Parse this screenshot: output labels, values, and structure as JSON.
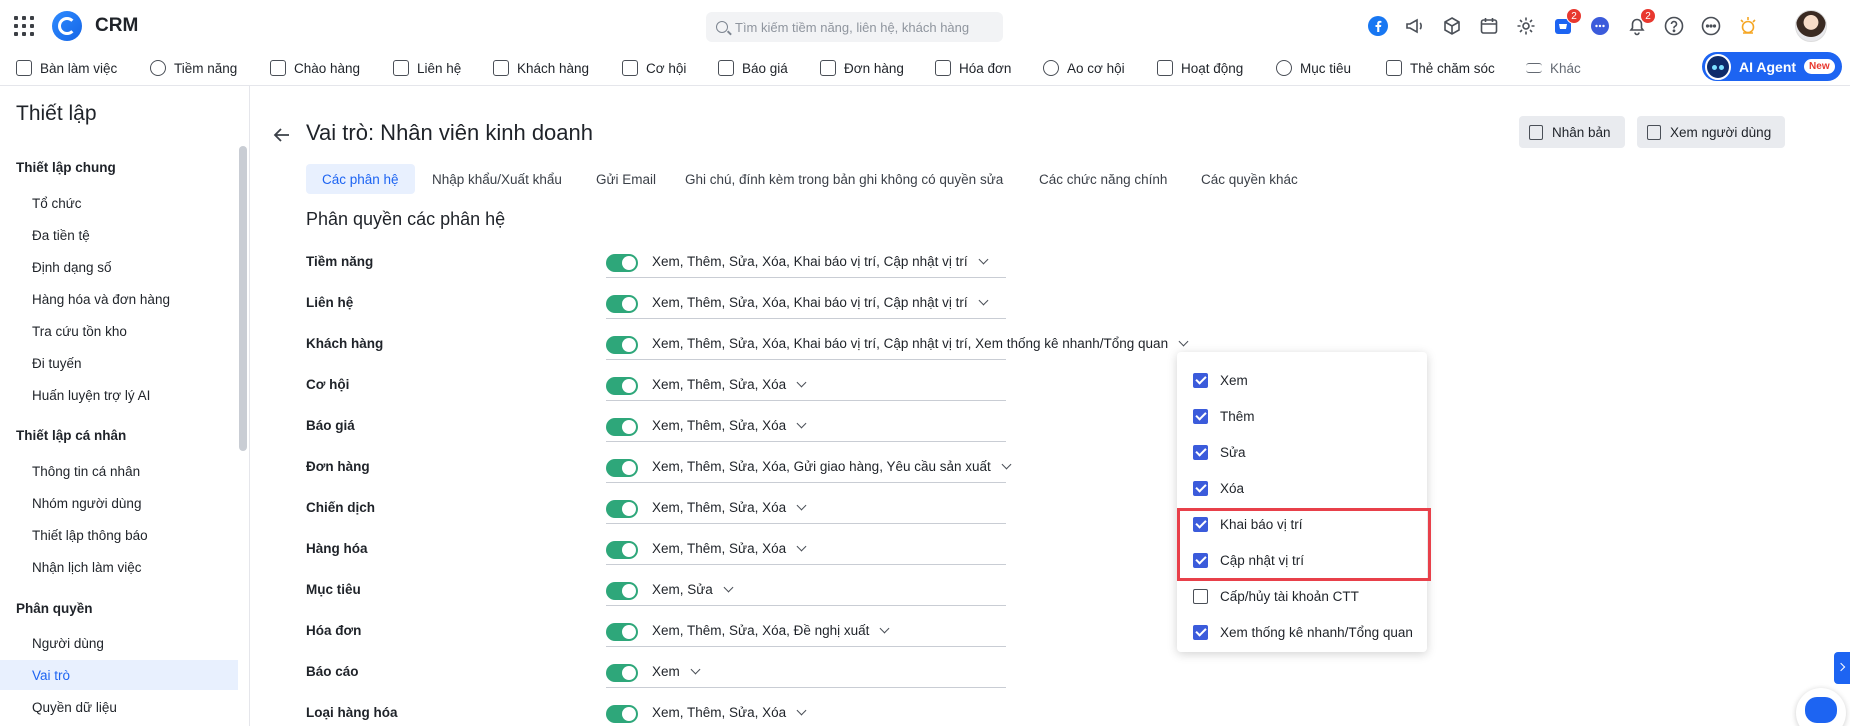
{
  "header": {
    "brand": "CRM",
    "search_placeholder": "Tìm kiếm tiềm năng, liên hệ, khách hàng",
    "cart_badge": "2",
    "notification_badge": "2"
  },
  "nav": {
    "items": [
      "Bàn làm việc",
      "Tiềm năng",
      "Chào hàng",
      "Liên hệ",
      "Khách hàng",
      "Cơ hội",
      "Báo giá",
      "Đơn hàng",
      "Hóa đơn",
      "Ao cơ hội",
      "Hoạt động",
      "Mục tiêu",
      "Thẻ chăm sóc",
      "Khác"
    ],
    "ai_label": "AI Agent",
    "ai_new": "New"
  },
  "sidebar": {
    "title": "Thiết lập",
    "groups": [
      {
        "label": "Thiết lập chung",
        "items": [
          "Tổ chức",
          "Đa tiền tệ",
          "Định dạng số",
          "Hàng hóa và đơn hàng",
          "Tra cứu tồn kho",
          "Đi tuyến",
          "Huấn luyện trợ lý AI"
        ]
      },
      {
        "label": "Thiết lập cá nhân",
        "items": [
          "Thông tin cá nhân",
          "Nhóm người dùng",
          "Thiết lập thông báo",
          "Nhận lịch làm việc"
        ]
      },
      {
        "label": "Phân quyền",
        "items": [
          "Người dùng",
          "Vai trò",
          "Quyền dữ liệu"
        ]
      }
    ],
    "active_item": "Vai trò"
  },
  "main": {
    "title": "Vai trò: Nhân viên kinh doanh",
    "duplicate_label": "Nhân bản",
    "view_users_label": "Xem người dùng",
    "tabs": [
      "Các phân hệ",
      "Nhập khẩu/Xuất khẩu",
      "Gửi Email",
      "Ghi chú, đính kèm trong bản ghi không có quyền sửa",
      "Các chức năng chính",
      "Các quyền khác"
    ],
    "active_tab": "Các phân hệ",
    "section_title": "Phân quyền các phân hệ",
    "modules": [
      {
        "label": "Tiềm năng",
        "enabled": true,
        "perms": "Xem, Thêm, Sửa, Xóa, Khai báo vị trí, Cập nhật vị trí"
      },
      {
        "label": "Liên hệ",
        "enabled": true,
        "perms": "Xem, Thêm, Sửa, Xóa, Khai báo vị trí, Cập nhật vị trí"
      },
      {
        "label": "Khách hàng",
        "enabled": true,
        "perms": "Xem, Thêm, Sửa, Xóa, Khai báo vị trí, Cập nhật vị trí, Xem thống kê nhanh/Tổng quan"
      },
      {
        "label": "Cơ hội",
        "enabled": true,
        "perms": "Xem, Thêm, Sửa, Xóa"
      },
      {
        "label": "Báo giá",
        "enabled": true,
        "perms": "Xem, Thêm, Sửa, Xóa"
      },
      {
        "label": "Đơn hàng",
        "enabled": true,
        "perms": "Xem, Thêm, Sửa, Xóa, Gửi giao hàng, Yêu cầu sản xuất"
      },
      {
        "label": "Chiến dịch",
        "enabled": true,
        "perms": "Xem, Thêm, Sửa, Xóa"
      },
      {
        "label": "Hàng hóa",
        "enabled": true,
        "perms": "Xem, Thêm, Sửa, Xóa"
      },
      {
        "label": "Mục tiêu",
        "enabled": true,
        "perms": "Xem, Sửa"
      },
      {
        "label": "Hóa đơn",
        "enabled": true,
        "perms": "Xem, Thêm, Sửa, Xóa, Đề nghị xuất"
      },
      {
        "label": "Báo cáo",
        "enabled": true,
        "perms": "Xem"
      },
      {
        "label": "Loại hàng hóa",
        "enabled": true,
        "perms": "Xem, Thêm, Sửa, Xóa"
      }
    ]
  },
  "dropdown": {
    "options": [
      {
        "label": "Xem",
        "checked": true
      },
      {
        "label": "Thêm",
        "checked": true
      },
      {
        "label": "Sửa",
        "checked": true
      },
      {
        "label": "Xóa",
        "checked": true
      },
      {
        "label": "Khai báo vị trí",
        "checked": true
      },
      {
        "label": "Cập nhật vị trí",
        "checked": true
      },
      {
        "label": "Cấp/hủy tài khoản CTT",
        "checked": false
      },
      {
        "label": "Xem thống kê nhanh/Tổng quan",
        "checked": true
      }
    ]
  },
  "colors": {
    "accent": "#1d64f2",
    "toggle_on": "#2ea77a",
    "highlight": "#e8404a",
    "checkbox": "#3b5bdb"
  }
}
